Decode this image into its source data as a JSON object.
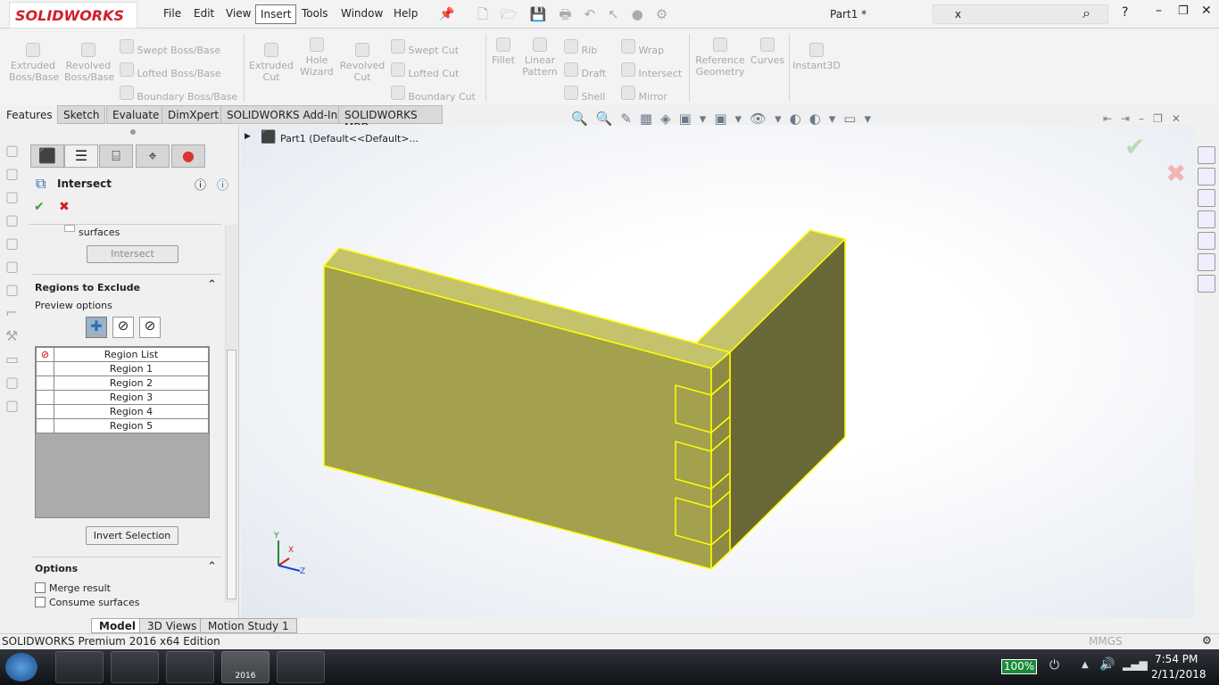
{
  "app": {
    "logo": "SOLIDWORKS",
    "doc_title": "Part1 *",
    "search_value": "x"
  },
  "menu": [
    "File",
    "Edit",
    "View",
    "Insert",
    "Tools",
    "Window",
    "Help"
  ],
  "ribbon": {
    "large": [
      "Extruded\nBoss/Base",
      "Revolved\nBoss/Base",
      "Extruded\nCut",
      "Hole\nWizard",
      "Revolved\nCut",
      "Fillet",
      "Linear\nPattern",
      "Reference\nGeometry",
      "Curves",
      "Instant3D"
    ],
    "small": [
      "Swept Boss/Base",
      "Lofted Boss/Base",
      "Boundary Boss/Base",
      "Swept Cut",
      "Lofted Cut",
      "Boundary Cut",
      "Rib",
      "Draft",
      "Shell",
      "Wrap",
      "Intersect",
      "Mirror"
    ]
  },
  "command_tabs": [
    "Features",
    "Sketch",
    "Evaluate",
    "DimXpert",
    "SOLIDWORKS Add-Ins",
    "SOLIDWORKS MBD"
  ],
  "tree": {
    "root": "Part1  (Default<<Default>..."
  },
  "panel": {
    "title": "Intersect",
    "surfaces_label": "surfaces",
    "intersect_button": "Intersect",
    "regions_heading": "Regions to Exclude",
    "preview_label": "Preview options",
    "region_list_header": "Region List",
    "regions": [
      "Region   1",
      "Region   2",
      "Region   3",
      "Region   4",
      "Region   5"
    ],
    "invert_button": "Invert Selection",
    "options_heading": "Options",
    "merge_result": "Merge result",
    "consume_surfaces": "Consume surfaces"
  },
  "bottom_tabs": [
    "Model",
    "3D Views",
    "Motion Study 1"
  ],
  "status": {
    "edition": "SOLIDWORKS Premium 2016 x64 Edition",
    "units": "MMGS"
  },
  "taskbar": {
    "battery": "100%",
    "time": "7:54 PM",
    "date": "2/11/2018",
    "sw_label": "2016"
  },
  "triad": {
    "x": "X",
    "y": "Y",
    "z": "Z"
  },
  "colors": {
    "model_face": "#a3a04e",
    "model_top": "#c5c26c",
    "model_side": "#6a6836",
    "edge": "#ffff00",
    "accept": "#3a9d3a",
    "cancel": "#d02020"
  }
}
